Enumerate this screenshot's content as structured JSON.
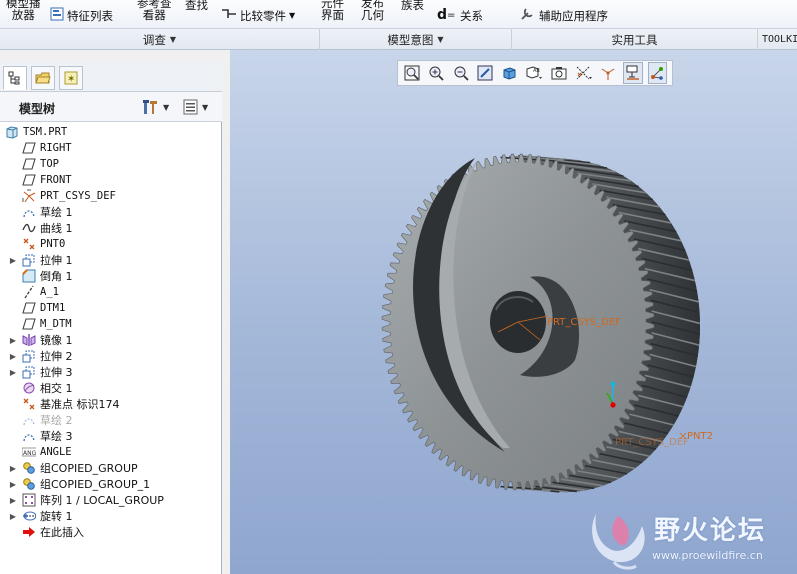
{
  "ribbon": {
    "model_player": [
      "模型播",
      "放器"
    ],
    "feature_list": "特征列表",
    "ref_viewer": [
      "参考查",
      "看器"
    ],
    "find": "查找",
    "compare_parts": "比较零件",
    "element_interface": [
      "元件",
      "界面"
    ],
    "publish_geometry": [
      "发布",
      "几何"
    ],
    "family_table": "族表",
    "relations": "关系",
    "aux_apps": "辅助应用程序"
  },
  "groups": {
    "investigate": "调查",
    "model_intent": "模型意图",
    "utilities": "实用工具",
    "toolkit": "TOOLKIT"
  },
  "left_panel": {
    "title": "模型树",
    "tabs": [
      "model-tree-tab",
      "folder-tab",
      "favorites-tab"
    ]
  },
  "tree": [
    {
      "label": "TSM.PRT",
      "icon": "part-icon",
      "level": 0,
      "expander": "",
      "mono": true
    },
    {
      "label": "RIGHT",
      "icon": "datum-plane-icon",
      "level": 1,
      "expander": "",
      "mono": true
    },
    {
      "label": "TOP",
      "icon": "datum-plane-icon",
      "level": 1,
      "expander": "",
      "mono": true
    },
    {
      "label": "FRONT",
      "icon": "datum-plane-icon",
      "level": 1,
      "expander": "",
      "mono": true
    },
    {
      "label": "PRT_CSYS_DEF",
      "icon": "csys-icon",
      "level": 1,
      "expander": "",
      "mono": true
    },
    {
      "label": "草绘 1",
      "icon": "sketch-icon",
      "level": 1,
      "expander": "",
      "mono": false
    },
    {
      "label": "曲线 1",
      "icon": "curve-icon",
      "level": 1,
      "expander": "",
      "mono": false
    },
    {
      "label": "PNT0",
      "icon": "datum-point-icon",
      "level": 1,
      "expander": "",
      "mono": true
    },
    {
      "label": "拉伸 1",
      "icon": "extrude-icon",
      "level": 1,
      "expander": "▶",
      "mono": false
    },
    {
      "label": "倒角 1",
      "icon": "chamfer-icon",
      "level": 1,
      "expander": "",
      "mono": false
    },
    {
      "label": "A_1",
      "icon": "axis-icon",
      "level": 1,
      "expander": "",
      "mono": true
    },
    {
      "label": "DTM1",
      "icon": "datum-plane-icon",
      "level": 1,
      "expander": "",
      "mono": true
    },
    {
      "label": "M_DTM",
      "icon": "datum-plane-icon",
      "level": 1,
      "expander": "",
      "mono": true
    },
    {
      "label": "镜像 1",
      "icon": "mirror-icon",
      "level": 1,
      "expander": "▶",
      "mono": false
    },
    {
      "label": "拉伸 2",
      "icon": "extrude-icon",
      "level": 1,
      "expander": "▶",
      "mono": false
    },
    {
      "label": "拉伸 3",
      "icon": "extrude-icon",
      "level": 1,
      "expander": "▶",
      "mono": false
    },
    {
      "label": "相交 1",
      "icon": "intersect-icon",
      "level": 1,
      "expander": "",
      "mono": false
    },
    {
      "label": "基准点 标识174",
      "icon": "datum-point-icon",
      "level": 1,
      "expander": "",
      "mono": false
    },
    {
      "label": "草绘 2",
      "icon": "sketch-icon",
      "level": 1,
      "expander": "",
      "mono": false,
      "disabled": true
    },
    {
      "label": "草绘 3",
      "icon": "sketch-icon",
      "level": 1,
      "expander": "",
      "mono": false
    },
    {
      "label": "ANGLE",
      "icon": "angle-icon",
      "level": 1,
      "expander": "",
      "mono": true
    },
    {
      "label": "组COPIED_GROUP",
      "icon": "group-icon",
      "level": 1,
      "expander": "▶",
      "mono": false
    },
    {
      "label": "组COPIED_GROUP_1",
      "icon": "group-icon",
      "level": 1,
      "expander": "▶",
      "mono": false
    },
    {
      "label": "阵列 1 / LOCAL_GROUP",
      "icon": "pattern-icon",
      "level": 1,
      "expander": "▶",
      "mono": false
    },
    {
      "label": "旋转 1",
      "icon": "revolve-icon",
      "level": 1,
      "expander": "▶",
      "mono": false
    },
    {
      "label": "在此插入",
      "icon": "insert-here-icon",
      "level": 1,
      "expander": "",
      "mono": false
    }
  ],
  "view_toolbar": [
    {
      "name": "refit-icon",
      "on": false
    },
    {
      "name": "zoom-in-icon",
      "on": false
    },
    {
      "name": "zoom-out-icon",
      "on": false
    },
    {
      "name": "repaint-icon",
      "on": false
    },
    {
      "name": "display-style-icon",
      "on": false
    },
    {
      "name": "saved-views-icon",
      "on": false
    },
    {
      "name": "view-manager-icon",
      "on": false
    },
    {
      "name": "datum-display-icon",
      "on": false
    },
    {
      "name": "spin-center-icon",
      "on": false
    },
    {
      "name": "annotation-display-icon",
      "on": true
    },
    {
      "name": "csys-display-icon",
      "on": true
    }
  ],
  "viewport": {
    "csys_label": "PRT_CSYS_DEF",
    "pnt_label": "PNT2",
    "pnt_label_faint": "PRT_CSYS_DEF",
    "watermark_title": "野火论坛",
    "watermark_url": "www.proewildfire.cn"
  },
  "colors": {
    "gear_face": "#8e9396",
    "gear_dark": "#3a3d40",
    "viewport_top": "#c8d5ea",
    "viewport_bottom": "#8fa6cf",
    "csys_orange": "#d2691e"
  }
}
